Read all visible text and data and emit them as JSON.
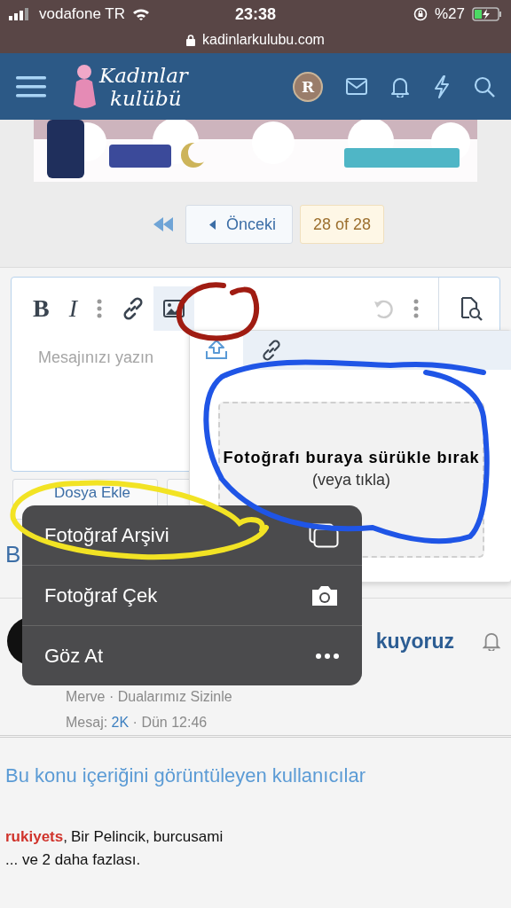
{
  "status_bar": {
    "carrier": "vodafone TR",
    "time": "23:38",
    "battery": "%27",
    "url": "kadinlarkulubu.com"
  },
  "header": {
    "logo": [
      "Kadınlar",
      "kulübü"
    ],
    "avatar_letter": "R"
  },
  "banner": {
    "kind": "picture"
  },
  "pager": {
    "previous": "Önceki",
    "page": "28 of 28"
  },
  "editor": {
    "bold": "B",
    "italic": "I",
    "placeholder": "Mesajınızı yazın"
  },
  "image_popup": {
    "tabs": [
      {
        "kind": "upload",
        "selected": true
      },
      {
        "kind": "link",
        "selected": false
      }
    ],
    "drop_text": "Fotoğrafı buraya sürükle bırak",
    "drop_hint": "(veya tıkla)"
  },
  "attach_buttons": [
    "Dosya Ekle"
  ],
  "action_menu": [
    {
      "label": "Fotoğraf Arşivi",
      "kind": "library"
    },
    {
      "label": "Fotoğraf Çek",
      "kind": "camera"
    },
    {
      "label": "Göz At",
      "kind": "browse"
    }
  ],
  "thread_heading": "B",
  "post": {
    "title": "kuyoruz",
    "meta": "Merve · Dualarımız Sizinle",
    "count_label": "Mesaj:",
    "count": "2K",
    "time": "· Dün 12:46"
  },
  "viewers": {
    "title": "Bu konu içeriğini görüntüleyen kullanıcılar",
    "users": [
      {
        "name": "rukiyets",
        "highlight": true
      },
      {
        "name": "Bir Pelincik",
        "highlight": false
      },
      {
        "name": "burcusami",
        "highlight": false
      }
    ],
    "separator": ",",
    "more": "... ve 2 daha fazlası."
  },
  "annotations": [
    {
      "color": "#a01c12"
    },
    {
      "color": "#1f55e6"
    },
    {
      "color": "#f2e324"
    }
  ]
}
